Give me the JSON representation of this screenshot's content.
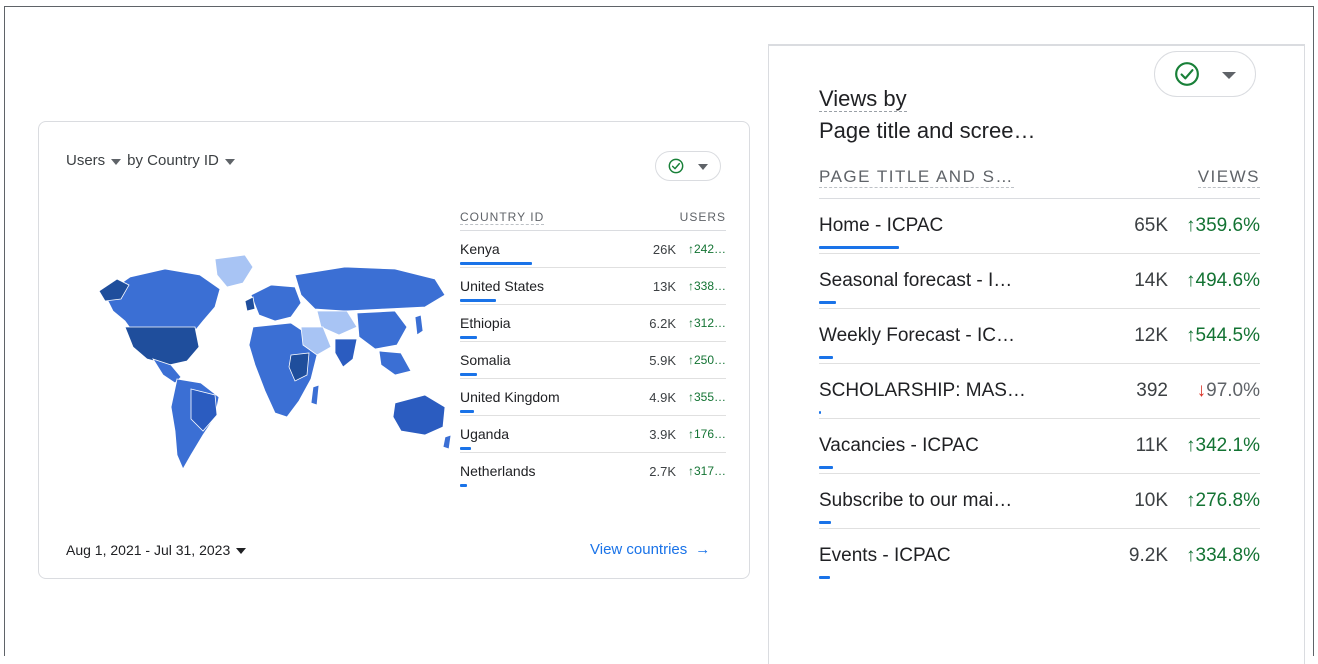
{
  "left_card": {
    "metric_label": "Users",
    "dimension_label": "by Country ID",
    "table": {
      "col_country": "COUNTRY ID",
      "col_users": "USERS",
      "rows": [
        {
          "country": "Kenya",
          "users": "26K",
          "change": "↑242…",
          "share": 1.0
        },
        {
          "country": "United States",
          "users": "13K",
          "change": "↑338…",
          "share": 0.5
        },
        {
          "country": "Ethiopia",
          "users": "6.2K",
          "change": "↑312…",
          "share": 0.24
        },
        {
          "country": "Somalia",
          "users": "5.9K",
          "change": "↑250…",
          "share": 0.23
        },
        {
          "country": "United Kingdom",
          "users": "4.9K",
          "change": "↑355…",
          "share": 0.19
        },
        {
          "country": "Uganda",
          "users": "3.9K",
          "change": "↑176…",
          "share": 0.15
        },
        {
          "country": "Netherlands",
          "users": "2.7K",
          "change": "↑317…",
          "share": 0.1
        }
      ]
    },
    "date_range": "Aug 1, 2021 - Jul 31, 2023",
    "view_link": "View countries",
    "view_link_arrow": "→"
  },
  "right_card": {
    "title_line1": "Views by",
    "title_line2": "Page title and scree…",
    "table": {
      "col_page": "PAGE TITLE AND S…",
      "col_views": "VIEWS",
      "rows": [
        {
          "page": "Home - ICPAC",
          "views": "65K",
          "arrow": "↑",
          "change": "359.6%",
          "direction": "up",
          "share": 1.0
        },
        {
          "page": "Seasonal forecast - I…",
          "views": "14K",
          "arrow": "↑",
          "change": "494.6%",
          "direction": "up",
          "share": 0.21
        },
        {
          "page": "Weekly Forecast - IC…",
          "views": "12K",
          "arrow": "↑",
          "change": "544.5%",
          "direction": "up",
          "share": 0.18
        },
        {
          "page": "SCHOLARSHIP: MAS…",
          "views": "392",
          "arrow": "↓",
          "change": "97.0%",
          "direction": "down",
          "share": 0.006
        },
        {
          "page": "Vacancies - ICPAC",
          "views": "11K",
          "arrow": "↑",
          "change": "342.1%",
          "direction": "up",
          "share": 0.17
        },
        {
          "page": "Subscribe to our mai…",
          "views": "10K",
          "arrow": "↑",
          "change": "276.8%",
          "direction": "up",
          "share": 0.15
        },
        {
          "page": "Events - ICPAC",
          "views": "9.2K",
          "arrow": "↑",
          "change": "334.8%",
          "direction": "up",
          "share": 0.14
        }
      ]
    }
  },
  "icons": {
    "compare": "check-circle-icon",
    "dropdown": "caret-down-icon",
    "map": "world-map"
  },
  "colors": {
    "accent_blue": "#1a73e8",
    "positive_green": "#137333",
    "negative_red": "#d93025",
    "map_dark": "#1f4e9c",
    "map_mid": "#3b6fd4",
    "map_light": "#a8c4f4"
  }
}
